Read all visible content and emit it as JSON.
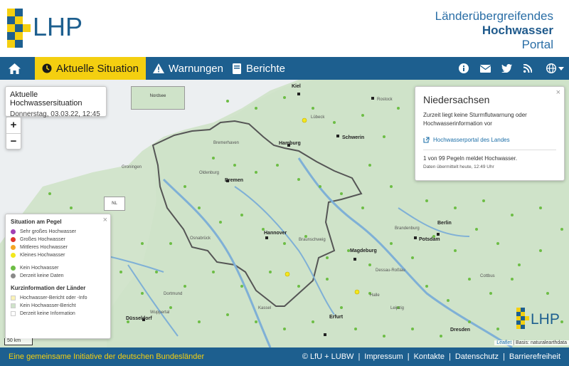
{
  "header": {
    "logo_text": "LHP",
    "title_line1": "Länderübergreifendes",
    "title_line2": "Hochwasser",
    "title_line3": "Portal"
  },
  "nav": {
    "home_icon": "home-icon",
    "items": [
      {
        "label": "Aktuelle Situation",
        "icon": "clock-icon",
        "active": true
      },
      {
        "label": "Warnungen",
        "icon": "warning-icon"
      },
      {
        "label": "Berichte",
        "icon": "book-icon"
      }
    ],
    "right_icons": [
      "info-icon",
      "mail-icon",
      "twitter-icon",
      "rss-icon",
      "globe-icon"
    ]
  },
  "map": {
    "situation": {
      "title": "Aktuelle Hochwassersituation",
      "date": "Donnerstag, 03.03.22, 12:45 Uhr"
    },
    "zoom": {
      "in": "+",
      "out": "−"
    },
    "sea_label": "Nordsee",
    "nl_label": "NL",
    "legend": {
      "close": "×",
      "title_pegel": "Situation am Pegel",
      "pegel_items": [
        {
          "label": "Sehr großes Hochwasser",
          "color": "#a13fb4"
        },
        {
          "label": "Großes Hochwasser",
          "color": "#e0352b"
        },
        {
          "label": "Mittleres Hochwasser",
          "color": "#f5a623"
        },
        {
          "label": "Kleines Hochwasser",
          "color": "#f2e81c"
        }
      ],
      "pegel_items2": [
        {
          "label": "Kein Hochwasser",
          "color": "#6dbd45"
        },
        {
          "label": "Derzeit keine Daten",
          "color": "#8a8a8a"
        }
      ],
      "title_kurz": "Kurzinformation der Länder",
      "kurz_items": [
        {
          "label": "Hochwasser-Bericht oder -Info",
          "color": "#fbf3b5"
        },
        {
          "label": "Kein Hochwasser-Bericht",
          "color": "#cfe3c9"
        },
        {
          "label": "Derzeit keine Information",
          "color": "#ffffff"
        }
      ]
    },
    "info": {
      "close": "×",
      "title": "Niedersachsen",
      "text": "Zurzeit liegt keine Sturmflutwarnung oder Hochwasserinformation vor",
      "link": "Hochwasserportal des Landes",
      "count": "1 von 99 Pegeln meldet Hochwasser.",
      "meta": "Daten übermittelt heute, 12:49 Uhr"
    },
    "cities": [
      {
        "name": "Kiel",
        "bold": true
      },
      {
        "name": "Rostock",
        "bold": false
      },
      {
        "name": "Lübeck",
        "bold": false
      },
      {
        "name": "Schwerin",
        "bold": true
      },
      {
        "name": "Hamburg",
        "bold": true
      },
      {
        "name": "Bremerhaven",
        "bold": false
      },
      {
        "name": "Groningen",
        "bold": false
      },
      {
        "name": "Oldenburg",
        "bold": false
      },
      {
        "name": "Bremen",
        "bold": true
      },
      {
        "name": "Berlin",
        "bold": true
      },
      {
        "name": "Brandenburg",
        "bold": false
      },
      {
        "name": "Potsdam",
        "bold": true
      },
      {
        "name": "Hannover",
        "bold": true
      },
      {
        "name": "Braunschweig",
        "bold": false
      },
      {
        "name": "Osnabrück",
        "bold": false
      },
      {
        "name": "Magdeburg",
        "bold": true
      },
      {
        "name": "Dessau-Roßlau",
        "bold": false
      },
      {
        "name": "Cottbus",
        "bold": false
      },
      {
        "name": "Dortmund",
        "bold": false
      },
      {
        "name": "Kassel",
        "bold": false
      },
      {
        "name": "Wuppertal",
        "bold": false
      },
      {
        "name": "Düsseldorf",
        "bold": true
      },
      {
        "name": "Leipzig",
        "bold": false
      },
      {
        "name": "Halle",
        "bold": false
      },
      {
        "name": "Erfurt",
        "bold": true
      },
      {
        "name": "Dresden",
        "bold": true
      }
    ],
    "scale": "50 km",
    "attribution_link": "Leaflet",
    "attribution_rest": "| Basis: naturalearthdata"
  },
  "footer": {
    "left": "Eine gemeinsame Initiative der deutschen Bundesländer",
    "links": [
      "© LfU + LUBW",
      "Impressum",
      "Kontakte",
      "Datenschutz",
      "Barrierefreiheit"
    ]
  }
}
